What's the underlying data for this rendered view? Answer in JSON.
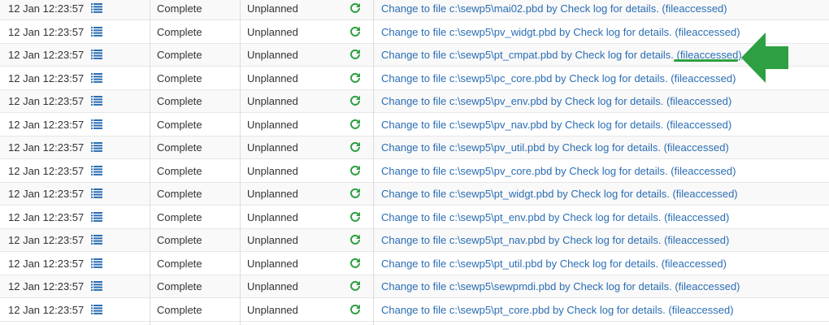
{
  "colors": {
    "link": "#2a6db3",
    "refresh_icon": "#2ea043",
    "list_icon": "#2a6db3",
    "annotation": "#2ea043"
  },
  "icons": {
    "list": "list-icon",
    "refresh": "refresh-icon",
    "annotation_arrow": "arrow-left-icon"
  },
  "rows": [
    {
      "time": "12 Jan 12:23:57",
      "status": "Complete",
      "plan": "Unplanned",
      "desc": "Change to file c:\\sewp5\\mai02.pbd by Check log for details. ",
      "tag": "(fileaccessed)"
    },
    {
      "time": "12 Jan 12:23:57",
      "status": "Complete",
      "plan": "Unplanned",
      "desc": "Change to file c:\\sewp5\\pv_widgt.pbd by Check log for details. ",
      "tag": "(fileaccessed)"
    },
    {
      "time": "12 Jan 12:23:57",
      "status": "Complete",
      "plan": "Unplanned",
      "desc": "Change to file c:\\sewp5\\pt_cmpat.pbd by Check log for details. ",
      "tag": "(fileaccessed)",
      "highlighted": true
    },
    {
      "time": "12 Jan 12:23:57",
      "status": "Complete",
      "plan": "Unplanned",
      "desc": "Change to file c:\\sewp5\\pc_core.pbd by Check log for details. ",
      "tag": "(fileaccessed)"
    },
    {
      "time": "12 Jan 12:23:57",
      "status": "Complete",
      "plan": "Unplanned",
      "desc": "Change to file c:\\sewp5\\pv_env.pbd by Check log for details. ",
      "tag": "(fileaccessed)"
    },
    {
      "time": "12 Jan 12:23:57",
      "status": "Complete",
      "plan": "Unplanned",
      "desc": "Change to file c:\\sewp5\\pv_nav.pbd by Check log for details. ",
      "tag": "(fileaccessed)"
    },
    {
      "time": "12 Jan 12:23:57",
      "status": "Complete",
      "plan": "Unplanned",
      "desc": "Change to file c:\\sewp5\\pv_util.pbd by Check log for details. ",
      "tag": "(fileaccessed)"
    },
    {
      "time": "12 Jan 12:23:57",
      "status": "Complete",
      "plan": "Unplanned",
      "desc": "Change to file c:\\sewp5\\pv_core.pbd by Check log for details. ",
      "tag": "(fileaccessed)"
    },
    {
      "time": "12 Jan 12:23:57",
      "status": "Complete",
      "plan": "Unplanned",
      "desc": "Change to file c:\\sewp5\\pt_widgt.pbd by Check log for details. ",
      "tag": "(fileaccessed)"
    },
    {
      "time": "12 Jan 12:23:57",
      "status": "Complete",
      "plan": "Unplanned",
      "desc": "Change to file c:\\sewp5\\pt_env.pbd by Check log for details. ",
      "tag": "(fileaccessed)"
    },
    {
      "time": "12 Jan 12:23:57",
      "status": "Complete",
      "plan": "Unplanned",
      "desc": "Change to file c:\\sewp5\\pt_nav.pbd by Check log for details. ",
      "tag": "(fileaccessed)"
    },
    {
      "time": "12 Jan 12:23:57",
      "status": "Complete",
      "plan": "Unplanned",
      "desc": "Change to file c:\\sewp5\\pt_util.pbd by Check log for details. ",
      "tag": "(fileaccessed)"
    },
    {
      "time": "12 Jan 12:23:57",
      "status": "Complete",
      "plan": "Unplanned",
      "desc": "Change to file c:\\sewp5\\sewpmdi.pbd by Check log for details. ",
      "tag": "(fileaccessed)"
    },
    {
      "time": "12 Jan 12:23:57",
      "status": "Complete",
      "plan": "Unplanned",
      "desc": "Change to file c:\\sewp5\\pt_core.pbd by Check log for details. ",
      "tag": "(fileaccessed)"
    }
  ]
}
